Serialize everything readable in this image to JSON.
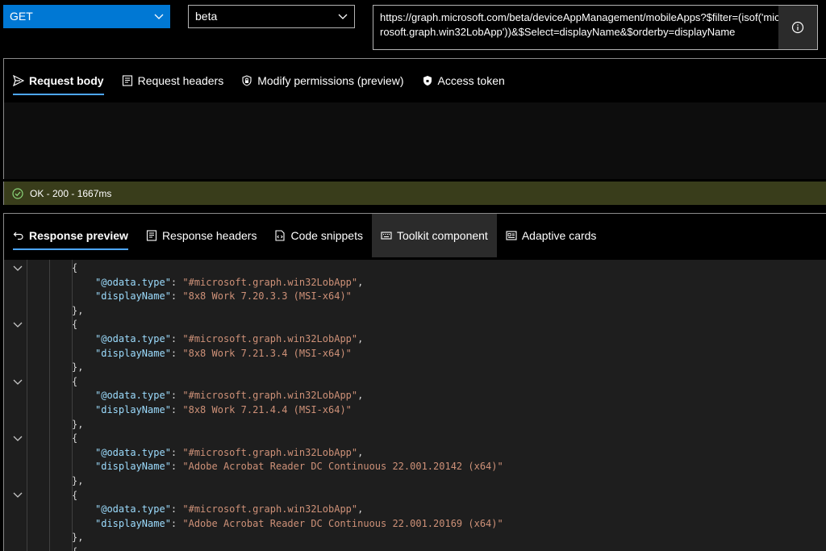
{
  "query": {
    "method": "GET",
    "version": "beta",
    "url": "https://graph.microsoft.com/beta/deviceAppManagement/mobileApps?$filter=(isof('microsoft.graph.win32LobApp'))&$Select=displayName&$orderby=displayName"
  },
  "request_tabs": [
    {
      "label": "Request body",
      "icon": "send-icon"
    },
    {
      "label": "Request headers",
      "icon": "document-icon"
    },
    {
      "label": "Modify permissions (preview)",
      "icon": "shield-lock-icon"
    },
    {
      "label": "Access token",
      "icon": "lock-icon"
    }
  ],
  "status": {
    "text": "OK - 200 - 1667ms",
    "color": "#393d1b",
    "icon": "check-circle-icon"
  },
  "response_tabs": [
    {
      "label": "Response preview",
      "icon": "undo-arrow-icon"
    },
    {
      "label": "Response headers",
      "icon": "document-icon"
    },
    {
      "label": "Code snippets",
      "icon": "code-file-icon"
    },
    {
      "label": "Toolkit component",
      "icon": "keyboard-icon"
    },
    {
      "label": "Adaptive cards",
      "icon": "card-icon"
    }
  ],
  "response": {
    "items": [
      {
        "type_key": "\"@odata.type\"",
        "type_value": "\"#microsoft.graph.win32LobApp\"",
        "name_key": "\"displayName\"",
        "name_value": "\"8x8 Work 7.20.3.3 (MSI-x64)\""
      },
      {
        "type_key": "\"@odata.type\"",
        "type_value": "\"#microsoft.graph.win32LobApp\"",
        "name_key": "\"displayName\"",
        "name_value": "\"8x8 Work 7.21.3.4 (MSI-x64)\""
      },
      {
        "type_key": "\"@odata.type\"",
        "type_value": "\"#microsoft.graph.win32LobApp\"",
        "name_key": "\"displayName\"",
        "name_value": "\"8x8 Work 7.21.4.4 (MSI-x64)\""
      },
      {
        "type_key": "\"@odata.type\"",
        "type_value": "\"#microsoft.graph.win32LobApp\"",
        "name_key": "\"displayName\"",
        "name_value": "\"Adobe Acrobat Reader DC Continuous 22.001.20142 (x64)\""
      },
      {
        "type_key": "\"@odata.type\"",
        "type_value": "\"#microsoft.graph.win32LobApp\"",
        "name_key": "\"displayName\"",
        "name_value": "\"Adobe Acrobat Reader DC Continuous 22.001.20169 (x64)\""
      }
    ]
  },
  "colors": {
    "accent": "#0078d4",
    "json_key": "#9cdcfe",
    "json_string": "#ce9178"
  }
}
